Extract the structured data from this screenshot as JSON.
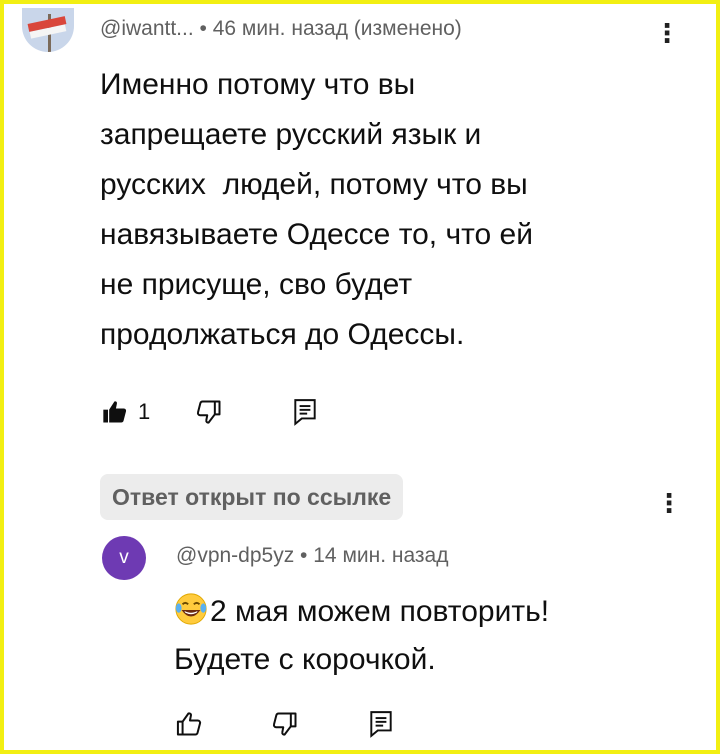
{
  "comment": {
    "author": "@iwantt...",
    "separator": " • ",
    "time": "46 мин. назад (изменено)",
    "lines": [
      "Именно потому что вы",
      "запрещаете русский язык и",
      "русских  людей, потому что вы",
      "навязываете Одессе то, что ей",
      "не присуще, сво будет",
      "продолжаться до Одессы."
    ],
    "like_count": "1"
  },
  "reply_chip": "Ответ открыт по ссылке",
  "reply": {
    "avatar_letter": "v",
    "author": "@vpn-dp5yz",
    "separator": " • ",
    "time": "14 мин. назад",
    "emoji": "joy-emoji",
    "lines": [
      "2 мая можем повторить!",
      "Будете с корочкой."
    ]
  },
  "icons": {
    "like": "thumbs-up-filled-icon",
    "dislike": "thumbs-down-icon",
    "reply": "reply-comment-icon",
    "menu": "more-vertical-icon"
  },
  "colors": {
    "border": "#f2ef12",
    "secondary_text": "#606060",
    "avatar2_bg": "#6e3ab3"
  }
}
